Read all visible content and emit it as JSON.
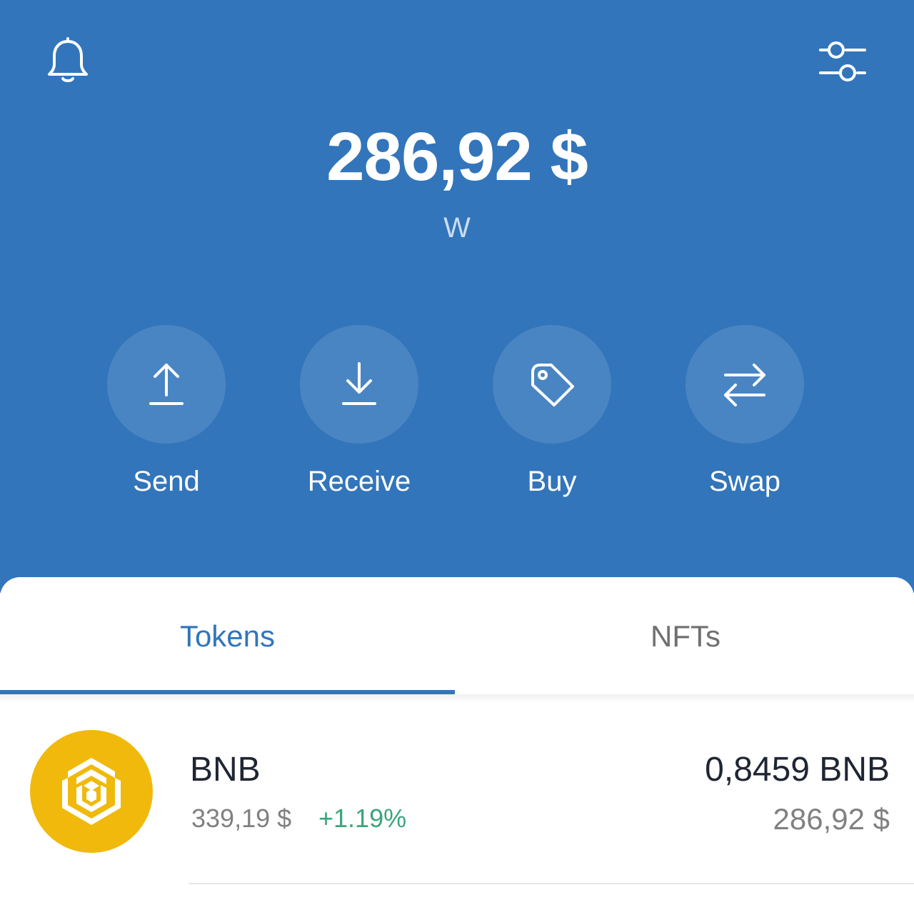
{
  "colors": {
    "header_bg": "#3275bb",
    "accent": "#3275bb",
    "positive": "#3aa57a",
    "bnb": "#f0b90b"
  },
  "header": {
    "balance": "286,92 $",
    "wallet_name": "W"
  },
  "actions": [
    {
      "label": "Send",
      "icon": "arrow-up-icon"
    },
    {
      "label": "Receive",
      "icon": "arrow-down-icon"
    },
    {
      "label": "Buy",
      "icon": "tag-icon"
    },
    {
      "label": "Swap",
      "icon": "swap-arrows-icon"
    }
  ],
  "tabs": [
    {
      "label": "Tokens",
      "active": true
    },
    {
      "label": "NFTs",
      "active": false
    }
  ],
  "tokens": [
    {
      "symbol": "BNB",
      "price": "339,19 $",
      "change": "+1.19%",
      "amount": "0,8459 BNB",
      "value": "286,92  $",
      "icon": "bnb-logo-icon"
    }
  ]
}
